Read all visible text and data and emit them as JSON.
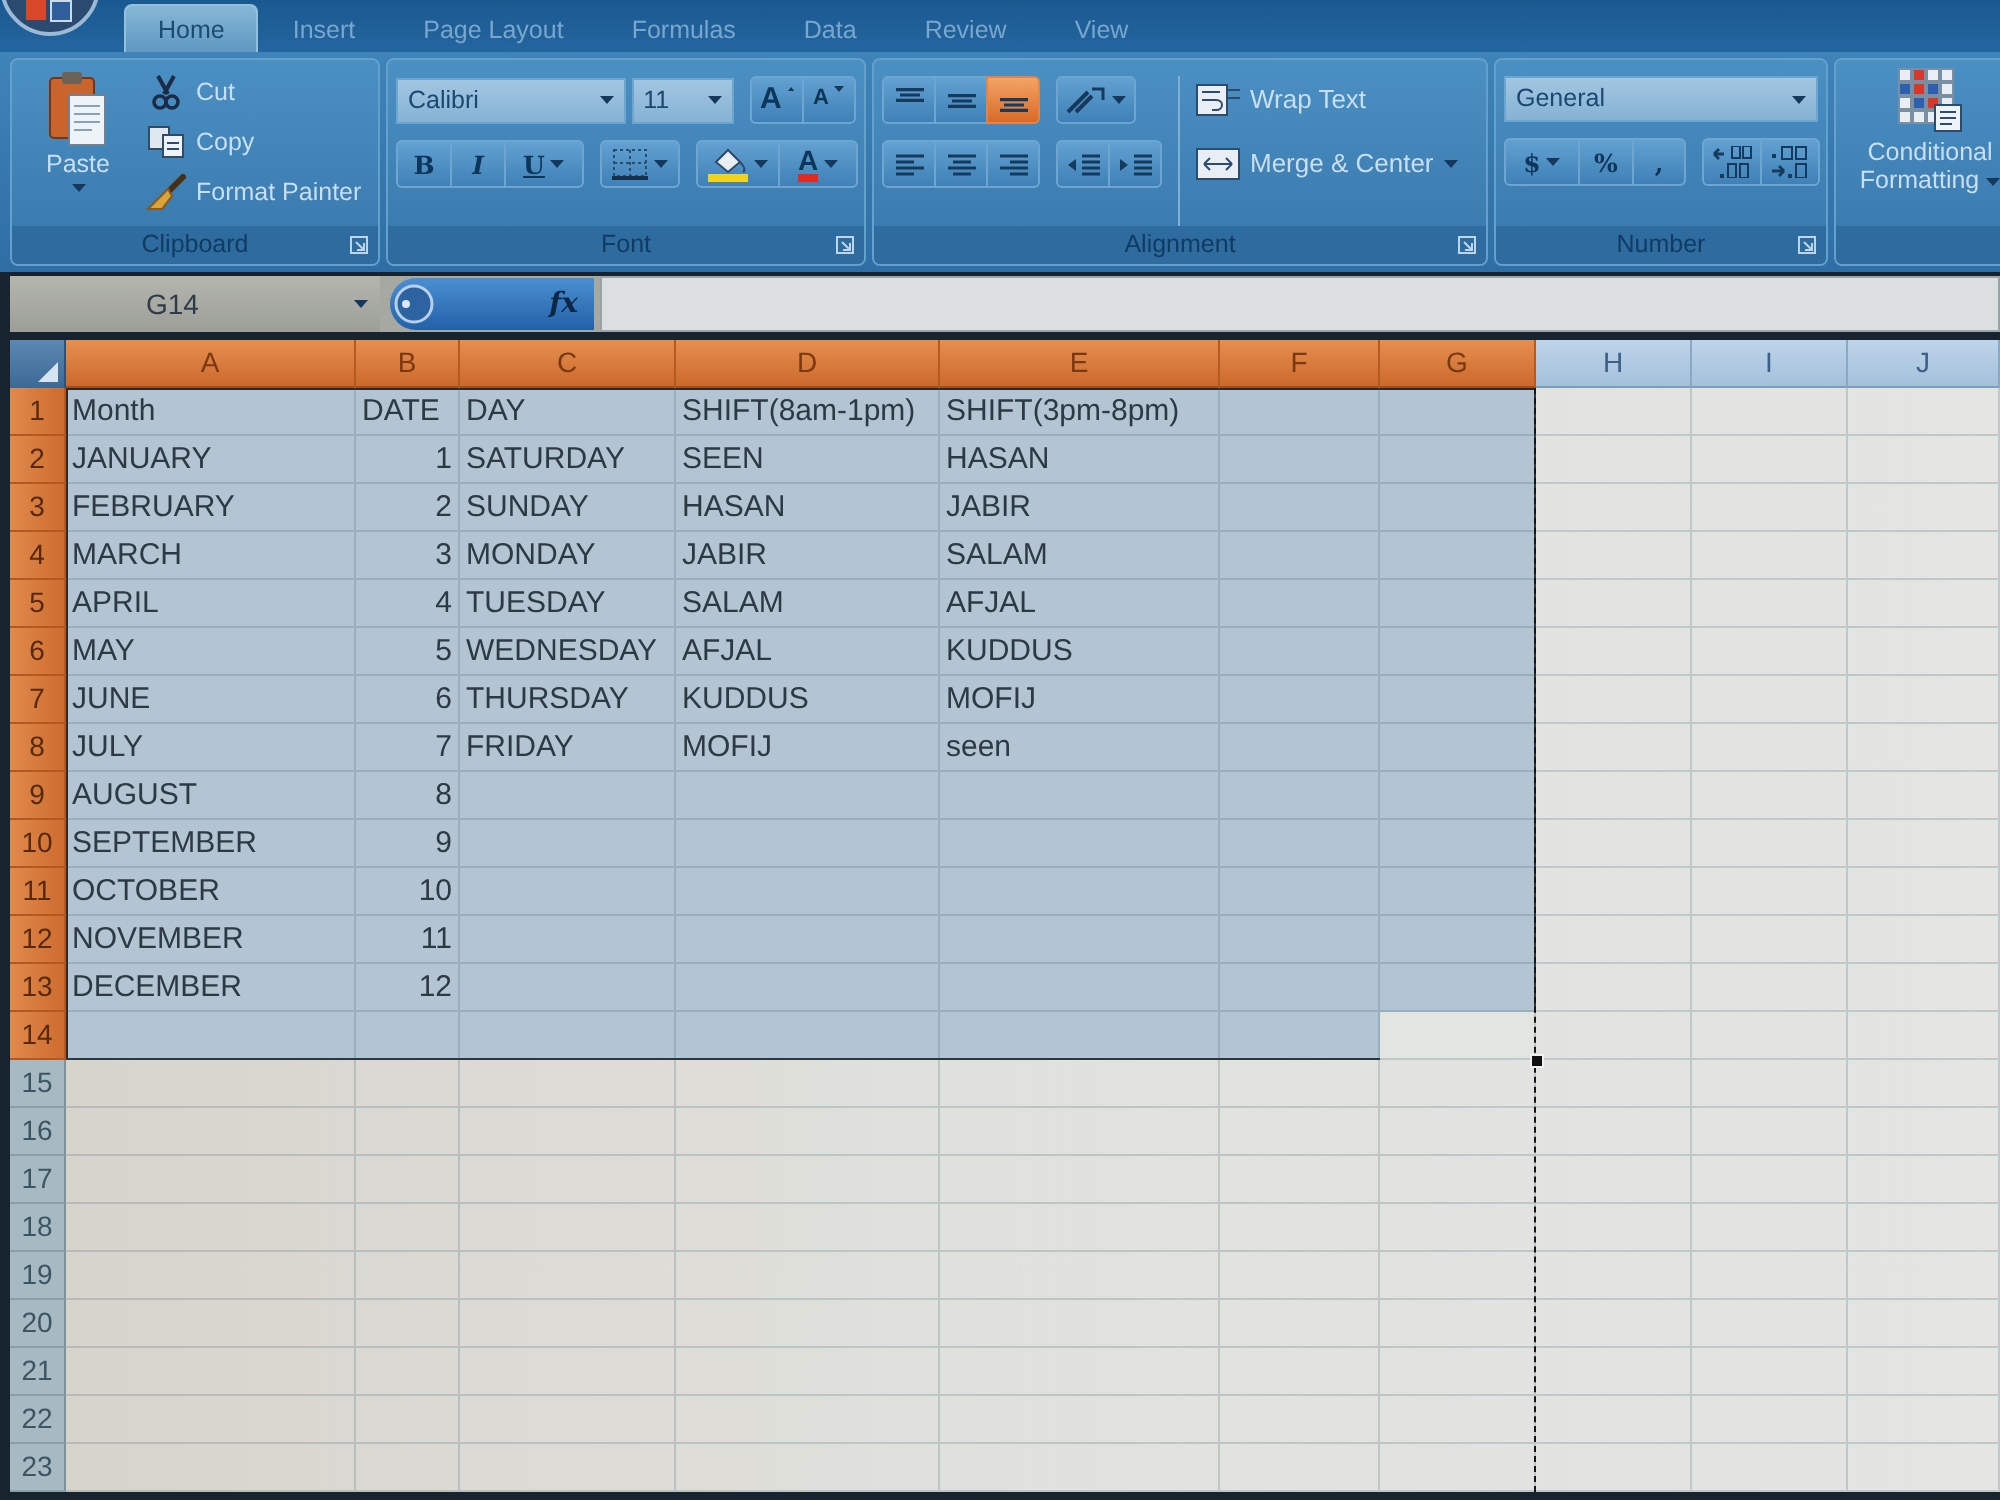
{
  "tabs": [
    {
      "label": "Home",
      "selected": true
    },
    {
      "label": "Insert",
      "selected": false
    },
    {
      "label": "Page Layout",
      "selected": false
    },
    {
      "label": "Formulas",
      "selected": false
    },
    {
      "label": "Data",
      "selected": false
    },
    {
      "label": "Review",
      "selected": false
    },
    {
      "label": "View",
      "selected": false
    }
  ],
  "ribbon": {
    "clipboard": {
      "title": "Clipboard",
      "paste": "Paste",
      "commands": [
        {
          "kind": "cut",
          "label": "Cut"
        },
        {
          "kind": "copy",
          "label": "Copy"
        },
        {
          "kind": "format_painter",
          "label": "Format Painter"
        }
      ]
    },
    "font": {
      "title": "Font",
      "font_name": "Calibri",
      "font_size": "11",
      "grow_label": "A",
      "shrink_label": "A",
      "bold": "B",
      "italic": "I",
      "underline": "U",
      "font_color_label": "A"
    },
    "alignment": {
      "title": "Alignment",
      "vertical": [
        {
          "kind": "top",
          "selected": false
        },
        {
          "kind": "middle",
          "selected": false
        },
        {
          "kind": "bottom",
          "selected": true
        }
      ],
      "horizontal": [
        {
          "kind": "left",
          "selected": false
        },
        {
          "kind": "center",
          "selected": false
        },
        {
          "kind": "right",
          "selected": false
        }
      ],
      "wrap_text": "Wrap Text",
      "merge_center": "Merge & Center"
    },
    "number": {
      "title": "Number",
      "format": "General",
      "currency": "$",
      "percent": "%",
      "comma": ","
    },
    "styles": {
      "conditional_formatting": "Conditional Formatting"
    }
  },
  "formula_bar": {
    "name_box": "G14",
    "function_label": "fx"
  },
  "columns": [
    {
      "label": "A",
      "selected": true,
      "active": false,
      "page_break": false
    },
    {
      "label": "B",
      "selected": true,
      "active": false,
      "page_break": false
    },
    {
      "label": "C",
      "selected": true,
      "active": false,
      "page_break": false
    },
    {
      "label": "D",
      "selected": true,
      "active": false,
      "page_break": false
    },
    {
      "label": "E",
      "selected": true,
      "active": false,
      "page_break": false
    },
    {
      "label": "F",
      "selected": true,
      "active": false,
      "page_break": false
    },
    {
      "label": "G",
      "selected": true,
      "active": true,
      "page_break": true
    },
    {
      "label": "H",
      "selected": false,
      "active": false,
      "page_break": false
    },
    {
      "label": "I",
      "selected": false,
      "active": false,
      "page_break": false
    },
    {
      "label": "J",
      "selected": false,
      "active": false,
      "page_break": false
    }
  ],
  "rows": [
    {
      "number": "1",
      "selected": true,
      "active": false,
      "cells": [
        {
          "text": "Month",
          "kind": "text"
        },
        {
          "text": "DATE",
          "kind": "text"
        },
        {
          "text": "DAY",
          "kind": "text"
        },
        {
          "text": "SHIFT(8am-1pm)",
          "kind": "text"
        },
        {
          "text": "SHIFT(3pm-8pm)",
          "kind": "text"
        }
      ]
    },
    {
      "number": "2",
      "selected": true,
      "active": false,
      "cells": [
        {
          "text": "JANUARY",
          "kind": "text"
        },
        {
          "text": "1",
          "kind": "number"
        },
        {
          "text": "SATURDAY",
          "kind": "text"
        },
        {
          "text": "SEEN",
          "kind": "text"
        },
        {
          "text": "HASAN",
          "kind": "text"
        }
      ]
    },
    {
      "number": "3",
      "selected": true,
      "active": false,
      "cells": [
        {
          "text": "FEBRUARY",
          "kind": "text"
        },
        {
          "text": "2",
          "kind": "number"
        },
        {
          "text": "SUNDAY",
          "kind": "text"
        },
        {
          "text": "HASAN",
          "kind": "text"
        },
        {
          "text": "JABIR",
          "kind": "text"
        }
      ]
    },
    {
      "number": "4",
      "selected": true,
      "active": false,
      "cells": [
        {
          "text": "MARCH",
          "kind": "text"
        },
        {
          "text": "3",
          "kind": "number"
        },
        {
          "text": "MONDAY",
          "kind": "text"
        },
        {
          "text": "JABIR",
          "kind": "text"
        },
        {
          "text": "SALAM",
          "kind": "text"
        }
      ]
    },
    {
      "number": "5",
      "selected": true,
      "active": false,
      "cells": [
        {
          "text": "APRIL",
          "kind": "text"
        },
        {
          "text": "4",
          "kind": "number"
        },
        {
          "text": "TUESDAY",
          "kind": "text"
        },
        {
          "text": "SALAM",
          "kind": "text"
        },
        {
          "text": "AFJAL",
          "kind": "text"
        }
      ]
    },
    {
      "number": "6",
      "selected": true,
      "active": false,
      "cells": [
        {
          "text": "MAY",
          "kind": "text"
        },
        {
          "text": "5",
          "kind": "number"
        },
        {
          "text": "WEDNESDAY",
          "kind": "text"
        },
        {
          "text": "AFJAL",
          "kind": "text"
        },
        {
          "text": "KUDDUS",
          "kind": "text"
        }
      ]
    },
    {
      "number": "7",
      "selected": true,
      "active": false,
      "cells": [
        {
          "text": "JUNE",
          "kind": "text"
        },
        {
          "text": "6",
          "kind": "number"
        },
        {
          "text": "THURSDAY",
          "kind": "text"
        },
        {
          "text": "KUDDUS",
          "kind": "text"
        },
        {
          "text": "MOFIJ",
          "kind": "text"
        }
      ]
    },
    {
      "number": "8",
      "selected": true,
      "active": false,
      "cells": [
        {
          "text": "JULY",
          "kind": "text"
        },
        {
          "text": "7",
          "kind": "number"
        },
        {
          "text": "FRIDAY",
          "kind": "text"
        },
        {
          "text": "MOFIJ",
          "kind": "text"
        },
        {
          "text": "seen",
          "kind": "text"
        }
      ]
    },
    {
      "number": "9",
      "selected": true,
      "active": false,
      "cells": [
        {
          "text": "AUGUST",
          "kind": "text"
        },
        {
          "text": "8",
          "kind": "number"
        }
      ]
    },
    {
      "number": "10",
      "selected": true,
      "active": false,
      "cells": [
        {
          "text": "SEPTEMBER",
          "kind": "text"
        },
        {
          "text": "9",
          "kind": "number"
        }
      ]
    },
    {
      "number": "11",
      "selected": true,
      "active": false,
      "cells": [
        {
          "text": "OCTOBER",
          "kind": "text"
        },
        {
          "text": "10",
          "kind": "number"
        }
      ]
    },
    {
      "number": "12",
      "selected": true,
      "active": false,
      "cells": [
        {
          "text": "NOVEMBER",
          "kind": "text"
        },
        {
          "text": "11",
          "kind": "number"
        }
      ]
    },
    {
      "number": "13",
      "selected": true,
      "active": false,
      "cells": [
        {
          "text": "DECEMBER",
          "kind": "text"
        },
        {
          "text": "12",
          "kind": "number"
        }
      ]
    },
    {
      "number": "14",
      "selected": true,
      "active": true
    },
    {
      "number": "15",
      "selected": false,
      "active": false
    },
    {
      "number": "16",
      "selected": false,
      "active": false
    },
    {
      "number": "17",
      "selected": false,
      "active": false
    },
    {
      "number": "18",
      "selected": false,
      "active": false
    },
    {
      "number": "19",
      "selected": false,
      "active": false
    },
    {
      "number": "20",
      "selected": false,
      "active": false
    },
    {
      "number": "21",
      "selected": false,
      "active": false
    },
    {
      "number": "22",
      "selected": false,
      "active": false
    },
    {
      "number": "23",
      "selected": false,
      "active": false
    }
  ]
}
